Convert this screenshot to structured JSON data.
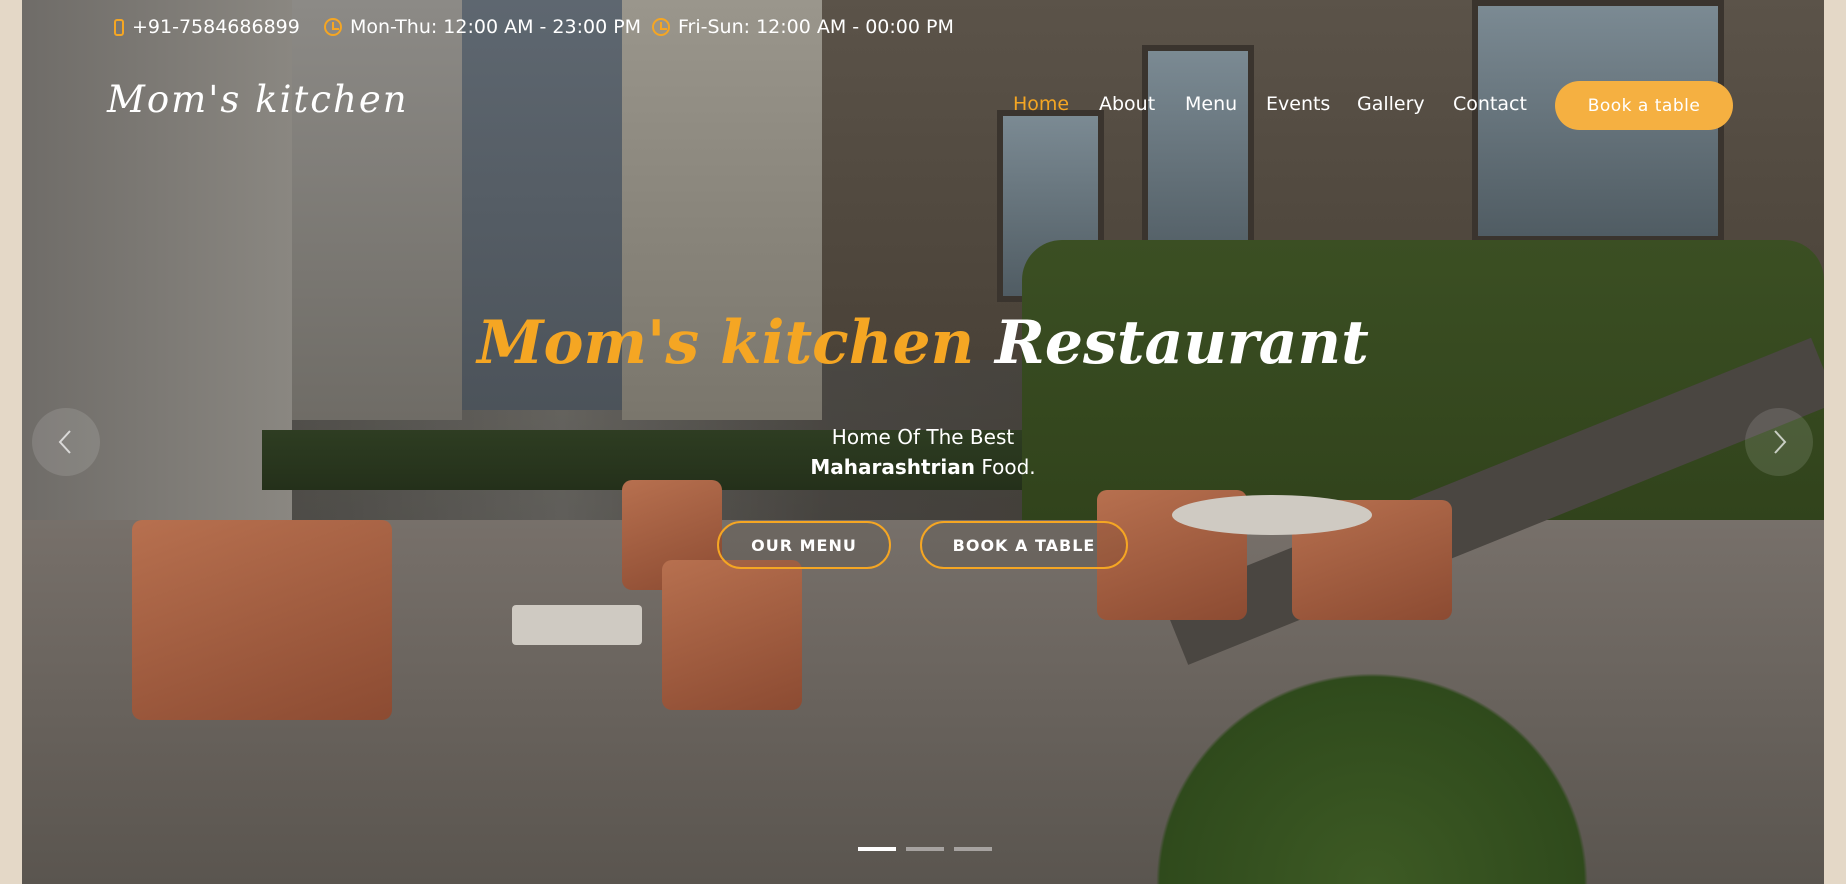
{
  "topbar": {
    "phone": "+91-7584686899",
    "hours_weekday": "Mon-Thu: 12:00 AM - 23:00 PM",
    "hours_weekend": "Fri-Sun: 12:00 AM - 00:00 PM"
  },
  "header": {
    "logo": "Mom's kitchen",
    "nav": [
      "Home",
      "About",
      "Menu",
      "Events",
      "Gallery",
      "Contact"
    ],
    "active_nav": "Home",
    "book_button": "Book a table"
  },
  "hero": {
    "title_brand": "Mom's kitchen",
    "title_rest": "Restaurant",
    "subtitle_line1": "Home Of The Best",
    "subtitle_bold": "Maharashtrian",
    "subtitle_rest": "Food.",
    "cta_menu": "OUR MENU",
    "cta_book": "BOOK A TABLE"
  },
  "carousel": {
    "slide_count": 3,
    "active_slide": 1
  },
  "colors": {
    "accent": "#f5a623",
    "button_bg": "#f5b041",
    "page_bg": "#e4d8c7"
  }
}
